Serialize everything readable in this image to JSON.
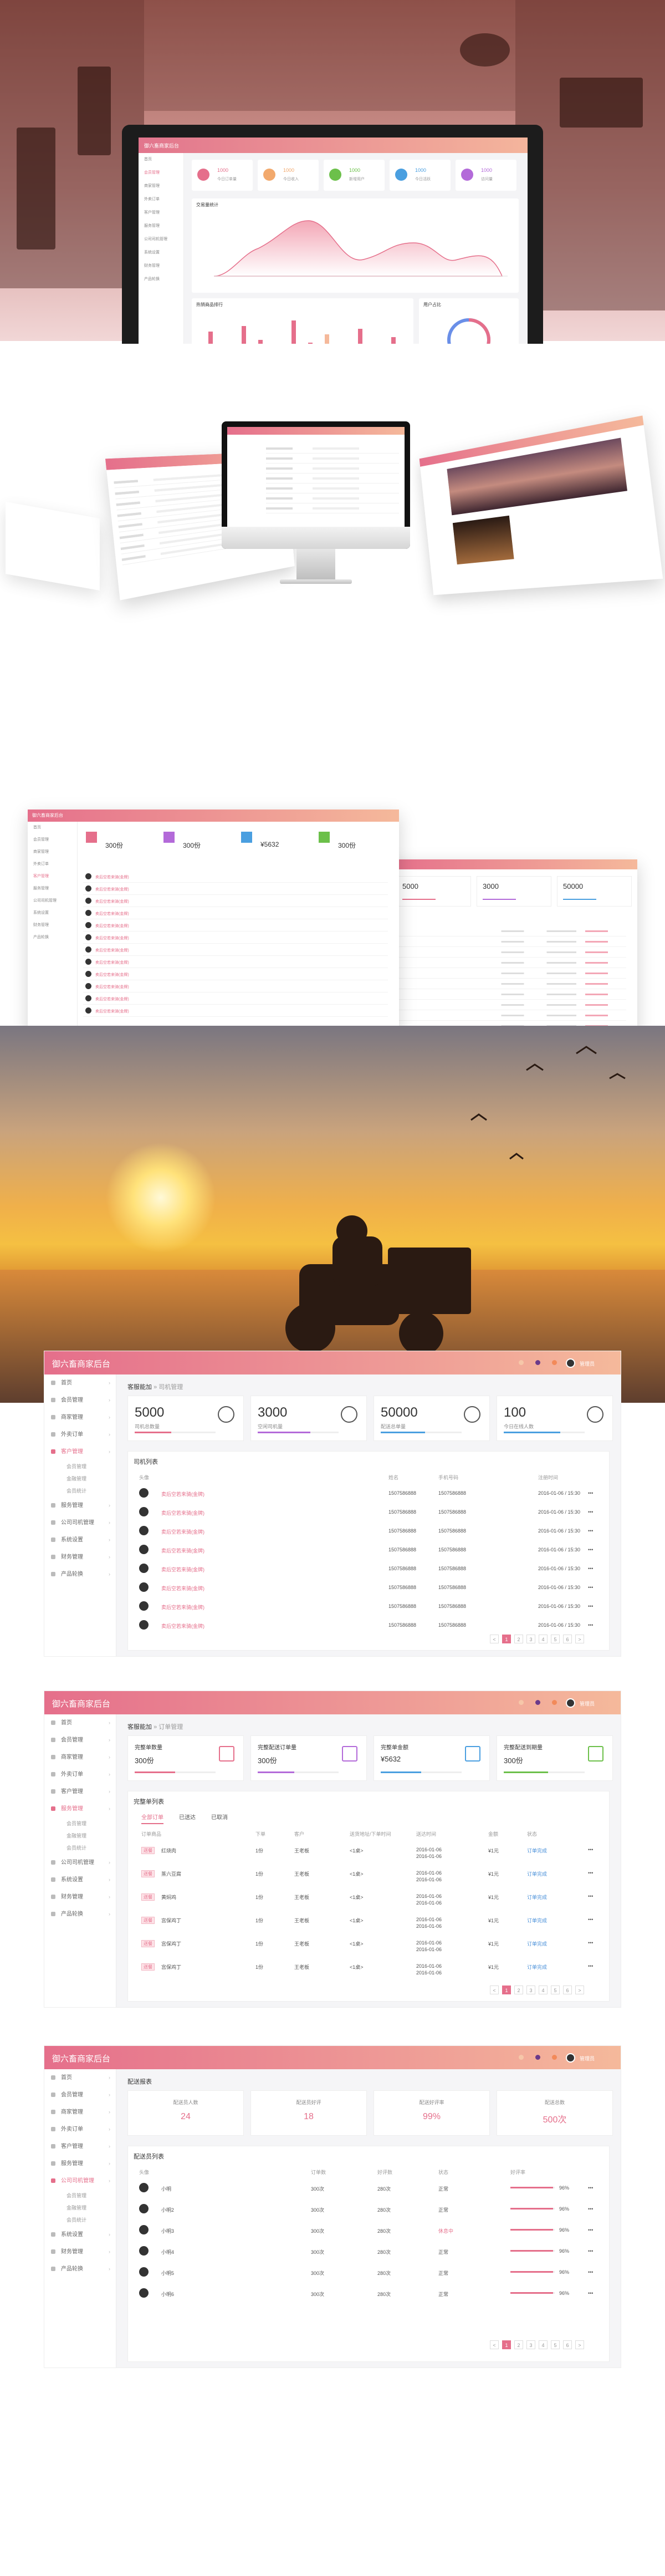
{
  "brand": {
    "title": "御六畜商家后台",
    "accent": "#e56f8b",
    "gradient_end": "#f5b99b"
  },
  "sidebar_items": [
    "首页",
    "会员管理",
    "商家管理",
    "外卖订单",
    "客户管理",
    "服务管理",
    "公司司机管理",
    "系统设置",
    "财务管理",
    "产品轮换"
  ],
  "sidebar_sub": [
    "会员管理",
    "金融管理",
    "会员统计"
  ],
  "laptop": {
    "stats": [
      {
        "value": "1000",
        "label": "今日订单量",
        "color": "#e56f8b"
      },
      {
        "value": "1000",
        "label": "今日收入",
        "color": "#f2a96d"
      },
      {
        "value": "1000",
        "label": "新增用户",
        "color": "#6cc04a"
      },
      {
        "value": "1000",
        "label": "今日活跃",
        "color": "#4a9fe0"
      },
      {
        "value": "1000",
        "label": "访问量",
        "color": "#b36ad9"
      }
    ],
    "chart_title": "交易量统计",
    "bar_title": "热销商品排行",
    "donut_title": "用户占比"
  },
  "drivers": {
    "crumb_main": "客服能加",
    "crumb_sub": "司机管理",
    "stats": [
      {
        "value": "5000",
        "label": "司机总数量",
        "color": "#e56f8b",
        "fill": 0.45
      },
      {
        "value": "3000",
        "label": "空闲司机量",
        "color": "#b36ad9",
        "fill": 0.65
      },
      {
        "value": "50000",
        "label": "配送总单量",
        "color": "#4a9fe0",
        "fill": 0.55
      },
      {
        "value": "100",
        "label": "今日在线人数",
        "color": "#4a9fe0",
        "fill": 0.7
      }
    ],
    "table_title": "司机列表",
    "headers": [
      "头像",
      "",
      "姓名",
      "手机号码",
      "注册时间",
      ""
    ],
    "rows": [
      {
        "name": "卖后空若来骑(金牌)",
        "p1": "1507586888",
        "p2": "1507586888",
        "t": "2016-01-06 / 15:30"
      },
      {
        "name": "卖后空若来骑(金牌)",
        "p1": "1507586888",
        "p2": "1507586888",
        "t": "2016-01-06 / 15:30"
      },
      {
        "name": "卖后空若来骑(金牌)",
        "p1": "1507586888",
        "p2": "1507586888",
        "t": "2016-01-06 / 15:30"
      },
      {
        "name": "卖后空若来骑(金牌)",
        "p1": "1507586888",
        "p2": "1507586888",
        "t": "2016-01-06 / 15:30"
      },
      {
        "name": "卖后空若来骑(金牌)",
        "p1": "1507586888",
        "p2": "1507586888",
        "t": "2016-01-06 / 15:30"
      },
      {
        "name": "卖后空若来骑(金牌)",
        "p1": "1507586888",
        "p2": "1507586888",
        "t": "2016-01-06 / 15:30"
      },
      {
        "name": "卖后空若来骑(金牌)",
        "p1": "1507586888",
        "p2": "1507586888",
        "t": "2016-01-06 / 15:30"
      },
      {
        "name": "卖后空若来骑(金牌)",
        "p1": "1507586888",
        "p2": "1507586888",
        "t": "2016-01-06 / 15:30"
      }
    ]
  },
  "orders": {
    "crumb_main": "客服能加",
    "crumb_sub": "订单管理",
    "stats": [
      {
        "title": "完整单数量",
        "value": "300份",
        "fill": 0.5,
        "color": "#e56f8b"
      },
      {
        "title": "完整配送订单量",
        "value": "300份",
        "fill": 0.45,
        "color": "#b36ad9"
      },
      {
        "title": "完整单金额",
        "value": "¥5632",
        "fill": 0.5,
        "color": "#4a9fe0"
      },
      {
        "title": "完整配送到期量",
        "value": "300份",
        "fill": 0.55,
        "color": "#6cc04a"
      }
    ],
    "table_title": "完整单列表",
    "tabs": [
      "全部订单",
      "已送达",
      "已取消"
    ],
    "headers": [
      "订单商品",
      "下单",
      "客户",
      "送货地址/下单时间",
      "送达时间",
      "金额",
      "状态",
      ""
    ],
    "rows": [
      {
        "item": "红烧肉",
        "tag": "送餐",
        "qty": "1份",
        "cust": "王老板",
        "addr": "<1桌>",
        "t1": "2016-01-06",
        "t2": "2016-01-06",
        "amt": "¥1元",
        "st": "订单完成"
      },
      {
        "item": "蒸六豆腐",
        "tag": "送餐",
        "qty": "1份",
        "cust": "王老板",
        "addr": "<1桌>",
        "t1": "2016-01-06",
        "t2": "2016-01-06",
        "amt": "¥1元",
        "st": "订单完成"
      },
      {
        "item": "黄焖鸡",
        "tag": "送餐",
        "qty": "1份",
        "cust": "王老板",
        "addr": "<1桌>",
        "t1": "2016-01-06",
        "t2": "2016-01-06",
        "amt": "¥1元",
        "st": "订单完成"
      },
      {
        "item": "宫保鸡丁",
        "tag": "送餐",
        "qty": "1份",
        "cust": "王老板",
        "addr": "<1桌>",
        "t1": "2016-01-06",
        "t2": "2016-01-06",
        "amt": "¥1元",
        "st": "订单完成"
      },
      {
        "item": "宫保鸡丁",
        "tag": "送餐",
        "qty": "1份",
        "cust": "王老板",
        "addr": "<1桌>",
        "t1": "2016-01-06",
        "t2": "2016-01-06",
        "amt": "¥1元",
        "st": "订单完成"
      },
      {
        "item": "宫保鸡丁",
        "tag": "送餐",
        "qty": "1份",
        "cust": "王老板",
        "addr": "<1桌>",
        "t1": "2016-01-06",
        "t2": "2016-01-06",
        "amt": "¥1元",
        "st": "订单完成"
      }
    ]
  },
  "delivery": {
    "crumb_main": "配送报表",
    "stats": [
      {
        "title": "配送员人数",
        "value": "24"
      },
      {
        "title": "配送员好评",
        "value": "18"
      },
      {
        "title": "配送好评率",
        "value": "99%"
      },
      {
        "title": "配送总数",
        "value": "500次"
      }
    ],
    "table_title": "配送员列表",
    "headers": [
      "头像",
      "",
      "订单数",
      "好评数",
      "状态",
      "好评率",
      ""
    ],
    "rows": [
      {
        "name": "小明",
        "orders": "300次",
        "good": "280次",
        "status": "正常",
        "rate": 0.96,
        "rate_txt": "96%"
      },
      {
        "name": "小明2",
        "orders": "300次",
        "good": "280次",
        "status": "正常",
        "rate": 0.96,
        "rate_txt": "96%"
      },
      {
        "name": "小明3",
        "orders": "300次",
        "good": "280次",
        "status": "休息中",
        "rate": 0.96,
        "rate_txt": "96%"
      },
      {
        "name": "小明4",
        "orders": "300次",
        "good": "280次",
        "status": "正常",
        "rate": 0.96,
        "rate_txt": "96%"
      },
      {
        "name": "小明5",
        "orders": "300次",
        "good": "280次",
        "status": "正常",
        "rate": 0.96,
        "rate_txt": "96%"
      },
      {
        "name": "小明6",
        "orders": "300次",
        "good": "280次",
        "status": "正常",
        "rate": 0.96,
        "rate_txt": "96%"
      }
    ]
  },
  "user": {
    "name": "管理员"
  },
  "pager": [
    "<",
    "1",
    "2",
    "3",
    "4",
    "5",
    "6",
    ">"
  ]
}
